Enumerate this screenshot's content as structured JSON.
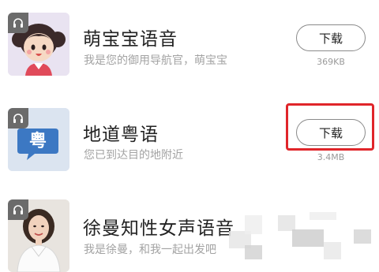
{
  "voice_packs": [
    {
      "title": "萌宝宝语音",
      "subtitle": "我是您的御用导航官，萌宝宝",
      "button_label": "下载",
      "file_size": "369KB",
      "thumbnail_icon": "cartoon-girl-avatar",
      "badge_icon": "headphones-icon"
    },
    {
      "title": "地道粤语",
      "subtitle": "您已到达目的地附近",
      "button_label": "下载",
      "file_size": "3.4MB",
      "thumbnail_icon": "cantonese-speech-bubble",
      "thumbnail_glyph": "粤",
      "badge_icon": "headphones-icon"
    },
    {
      "title": "徐曼知性女声语音",
      "subtitle": "我是徐曼，和我一起出发吧",
      "thumbnail_icon": "woman-portrait",
      "badge_icon": "headphones-icon"
    }
  ],
  "colors": {
    "highlight": "#e0252a",
    "title": "#222222",
    "subtitle": "#a3a3a3",
    "button_border": "#8a8a8a",
    "badge": "#6b6b6b"
  }
}
